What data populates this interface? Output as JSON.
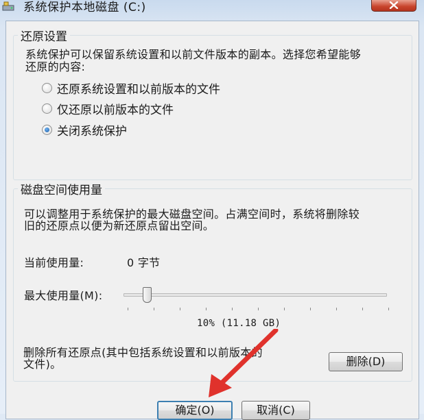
{
  "window": {
    "title": "系统保护本地磁盘 (C:)"
  },
  "restore": {
    "group_title": "还原设置",
    "description_line1": "系统保护可以保留系统设置和以前文件版本的副本。选择您希望能够",
    "description_line2": "还原的内容:",
    "options": [
      {
        "label": "还原系统设置和以前版本的文件",
        "selected": false
      },
      {
        "label": "仅还原以前版本的文件",
        "selected": false
      },
      {
        "label": "关闭系统保护",
        "selected": true
      }
    ]
  },
  "disk": {
    "group_title": "磁盘空间使用量",
    "description_line1": "可以调整用于系统保护的最大磁盘空间。占满空间时，系统将删除较",
    "description_line2": "旧的还原点以便为新还原点留出空间。",
    "current_label": "当前使用量:",
    "current_value": "0 字节",
    "max_label": "最大使用量(M):",
    "max_value_text": "10% (11.18 GB)",
    "max_percent": 10,
    "delete_text_line1": "删除所有还原点(其中包括系统设置和以前版本的",
    "delete_text_line2": "文件)。",
    "delete_button": "删除(D)"
  },
  "footer": {
    "ok_button": "确定(O)",
    "cancel_button": "取消(C)"
  },
  "colors": {
    "annotation_arrow": "#e0322c",
    "default_button_border": "#3c7fb1"
  }
}
